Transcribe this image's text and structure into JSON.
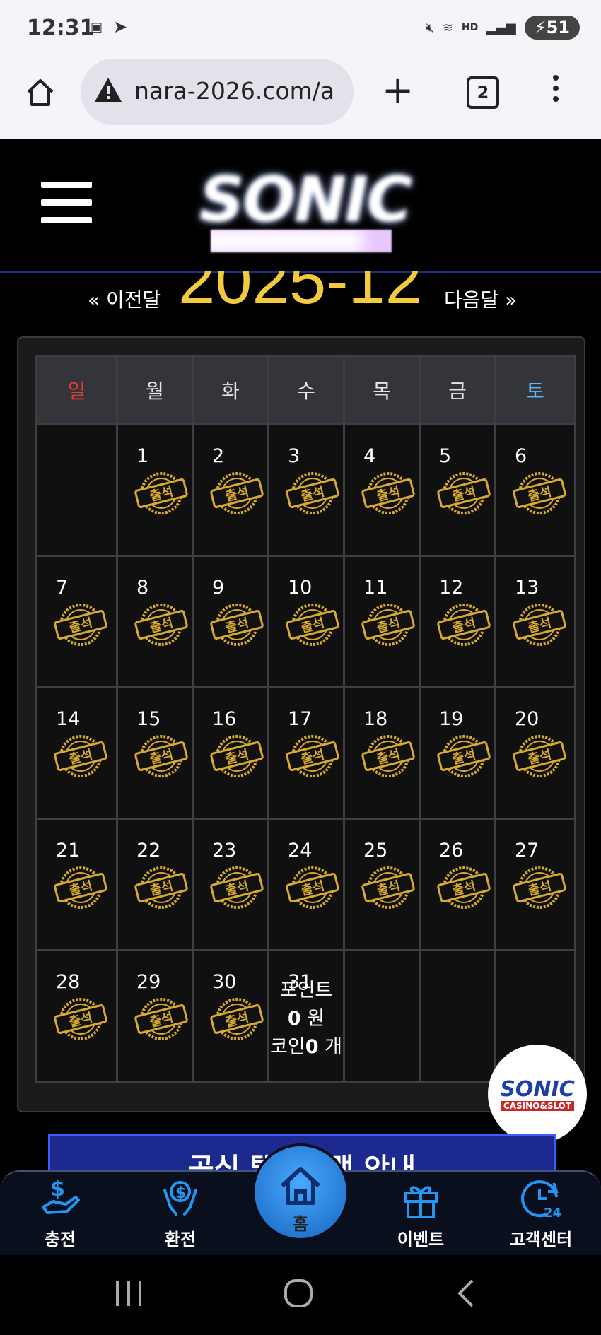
{
  "status_bar": {
    "time": "12:31",
    "battery": "51",
    "hd": "HD"
  },
  "browser": {
    "url": "nara-2026.com/a",
    "tab_count": "2"
  },
  "month_nav": {
    "prev": "« 이전달",
    "current": "2025-12",
    "next": "다음달 »"
  },
  "calendar": {
    "weekdays": [
      "일",
      "월",
      "화",
      "수",
      "목",
      "금",
      "토"
    ],
    "weeks": [
      [
        "",
        "1",
        "2",
        "3",
        "4",
        "5",
        "6"
      ],
      [
        "7",
        "8",
        "9",
        "10",
        "11",
        "12",
        "13"
      ],
      [
        "14",
        "15",
        "16",
        "17",
        "18",
        "19",
        "20"
      ],
      [
        "21",
        "22",
        "23",
        "24",
        "25",
        "26",
        "27"
      ],
      [
        "28",
        "29",
        "30",
        "31",
        "",
        "",
        ""
      ]
    ],
    "stamp_text": "출석",
    "points_label": "포인트",
    "points_value": "0",
    "points_unit": "원",
    "coin_label": "코인",
    "coin_value": "0",
    "coin_unit": "개"
  },
  "floating_badge": {
    "brand": "SONIC",
    "sub": "CASINO&SLOT"
  },
  "banner": {
    "text": "공식 텔레그램 안내"
  },
  "bottom_nav": [
    {
      "label": "충전",
      "icon": "deposit-icon"
    },
    {
      "label": "환전",
      "icon": "withdraw-icon"
    },
    {
      "label": "홈",
      "icon": "home-icon"
    },
    {
      "label": "이벤트",
      "icon": "gift-icon"
    },
    {
      "label": "고객센터",
      "icon": "support-24-icon"
    }
  ],
  "colors": {
    "accent": "#f3c93d",
    "sunday": "#e23b3b",
    "saturday": "#62b8ff",
    "nav_blue": "#1e88e5"
  }
}
